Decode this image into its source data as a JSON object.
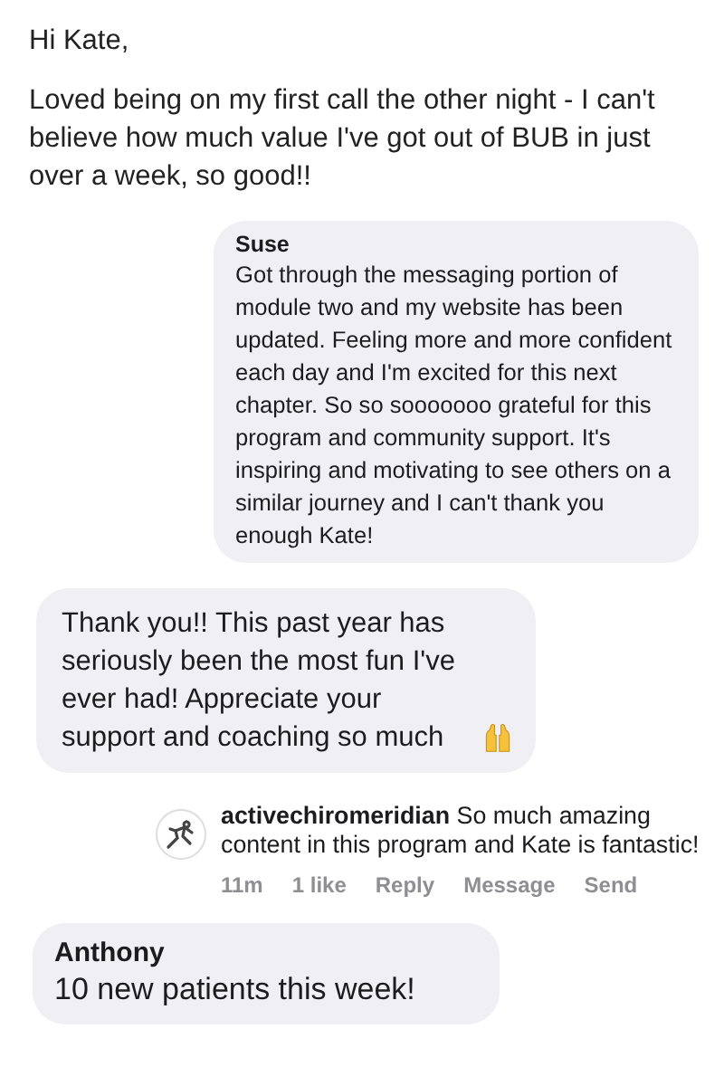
{
  "greeting": "Hi Kate,",
  "intro": "Loved being on my first call the other night - I can't believe how much value I've got out of BUB in just over a week, so good!!",
  "quoted_message": {
    "author": "Suse",
    "text": "Got through the messaging portion of module two and my website has been updated. Feeling more and more confident each day and I'm excited for this next chapter. So so sooooooo grateful for this program and community support. It's inspiring and motivating to see others on a similar journey and I can't thank you enough Kate!"
  },
  "reply_message": {
    "text": "Thank you!! This past year has seriously been the most fun I've ever had! Appreciate your support and coaching so much"
  },
  "comment": {
    "username": "activechiromeridian",
    "text": "So much amazing content in this program and Kate is fantastic!",
    "time": "11m",
    "likes": "1 like",
    "actions": [
      "Reply",
      "Message",
      "Send"
    ]
  },
  "last_message": {
    "author": "Anthony",
    "text": "10 new patients this week!"
  }
}
